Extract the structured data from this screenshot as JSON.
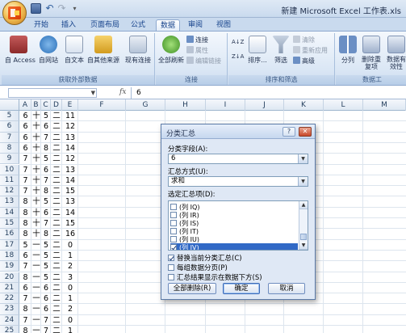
{
  "window": {
    "title": "新建 Microsoft Excel 工作表.xls"
  },
  "qat": {
    "undo_glyph": "↶",
    "redo_glyph": "↷",
    "more_glyph": "▾"
  },
  "tabs": [
    {
      "label": "开始"
    },
    {
      "label": "插入"
    },
    {
      "label": "页面布局"
    },
    {
      "label": "公式"
    },
    {
      "label": "数据"
    },
    {
      "label": "审阅"
    },
    {
      "label": "视图"
    }
  ],
  "active_tab": "数据",
  "ribbon": {
    "external": {
      "group_label": "获取外部数据",
      "access": "自 Access",
      "web": "自网站",
      "text": "自文本",
      "other": "自其他来源",
      "existing": "现有连接"
    },
    "connections": {
      "group_label": "连接",
      "refresh_all": "全部刷新",
      "connections": "连接",
      "properties": "属性",
      "edit_links": "编辑链接"
    },
    "sort_filter": {
      "group_label": "排序和筛选",
      "sort_az": "A↓Z",
      "sort_za": "Z↓A",
      "sort": "排序...",
      "filter": "筛选",
      "clear": "清除",
      "reapply": "重新应用",
      "advanced": "高级"
    },
    "tools": {
      "group_label": "数据工",
      "split": "分列",
      "remove_dup": "删除重复项",
      "validate": "数据有效性"
    }
  },
  "formula_bar": {
    "fx": "fx",
    "value": "6"
  },
  "grid": {
    "columns": [
      "A",
      "B",
      "C",
      "D",
      "E",
      "F",
      "G",
      "H",
      "I",
      "J",
      "K",
      "L",
      "M"
    ],
    "rows": [
      {
        "n": "5",
        "a": "6",
        "b": "十",
        "c": "5",
        "d": "二",
        "e": "11"
      },
      {
        "n": "6",
        "a": "6",
        "b": "十",
        "c": "6",
        "d": "二",
        "e": "12"
      },
      {
        "n": "7",
        "a": "6",
        "b": "十",
        "c": "7",
        "d": "二",
        "e": "13"
      },
      {
        "n": "8",
        "a": "6",
        "b": "十",
        "c": "8",
        "d": "二",
        "e": "14"
      },
      {
        "n": "9",
        "a": "7",
        "b": "十",
        "c": "5",
        "d": "二",
        "e": "12"
      },
      {
        "n": "10",
        "a": "7",
        "b": "十",
        "c": "6",
        "d": "二",
        "e": "13"
      },
      {
        "n": "11",
        "a": "7",
        "b": "十",
        "c": "7",
        "d": "二",
        "e": "14"
      },
      {
        "n": "12",
        "a": "7",
        "b": "十",
        "c": "8",
        "d": "二",
        "e": "15"
      },
      {
        "n": "13",
        "a": "8",
        "b": "十",
        "c": "5",
        "d": "二",
        "e": "13"
      },
      {
        "n": "14",
        "a": "8",
        "b": "十",
        "c": "6",
        "d": "二",
        "e": "14"
      },
      {
        "n": "15",
        "a": "8",
        "b": "十",
        "c": "7",
        "d": "二",
        "e": "15"
      },
      {
        "n": "16",
        "a": "8",
        "b": "十",
        "c": "8",
        "d": "二",
        "e": "16"
      },
      {
        "n": "17",
        "a": "5",
        "b": "一",
        "c": "5",
        "d": "二",
        "e": "0"
      },
      {
        "n": "18",
        "a": "6",
        "b": "一",
        "c": "5",
        "d": "二",
        "e": "1"
      },
      {
        "n": "19",
        "a": "7",
        "b": "一",
        "c": "5",
        "d": "二",
        "e": "2"
      },
      {
        "n": "20",
        "a": "8",
        "b": "一",
        "c": "5",
        "d": "二",
        "e": "3"
      },
      {
        "n": "21",
        "a": "6",
        "b": "一",
        "c": "6",
        "d": "二",
        "e": "0"
      },
      {
        "n": "22",
        "a": "7",
        "b": "一",
        "c": "6",
        "d": "二",
        "e": "1"
      },
      {
        "n": "23",
        "a": "8",
        "b": "一",
        "c": "6",
        "d": "二",
        "e": "2"
      },
      {
        "n": "24",
        "a": "7",
        "b": "一",
        "c": "7",
        "d": "二",
        "e": "0"
      },
      {
        "n": "25",
        "a": "8",
        "b": "一",
        "c": "7",
        "d": "二",
        "e": "1"
      },
      {
        "n": "26",
        "a": "8",
        "b": "一",
        "c": "8",
        "d": "二",
        "e": "0"
      }
    ]
  },
  "dialog": {
    "title": "分类汇总",
    "help": "?",
    "close": "✕",
    "group_by_label": "分类字段(A):",
    "group_by_value": "6",
    "function_label": "汇总方式(U):",
    "function_value": "求和",
    "items_label": "选定汇总项(D):",
    "items": [
      {
        "label": "(列 IQ)",
        "checked": false,
        "selected": false
      },
      {
        "label": "(列 IR)",
        "checked": false,
        "selected": false
      },
      {
        "label": "(列 IS)",
        "checked": false,
        "selected": false
      },
      {
        "label": "(列 IT)",
        "checked": false,
        "selected": false
      },
      {
        "label": "(列 IU)",
        "checked": false,
        "selected": false
      },
      {
        "label": "(列 IV)",
        "checked": true,
        "selected": true
      }
    ],
    "opt_replace": "替换当前分类汇总(C)",
    "opt_replace_checked": true,
    "opt_pagebreak": "每组数据分页(P)",
    "opt_pagebreak_checked": false,
    "opt_below": "汇总结果显示在数据下方(S)",
    "opt_below_checked": false,
    "btn_remove_all": "全部删除(R)",
    "btn_ok": "确定",
    "btn_cancel": "取消"
  }
}
